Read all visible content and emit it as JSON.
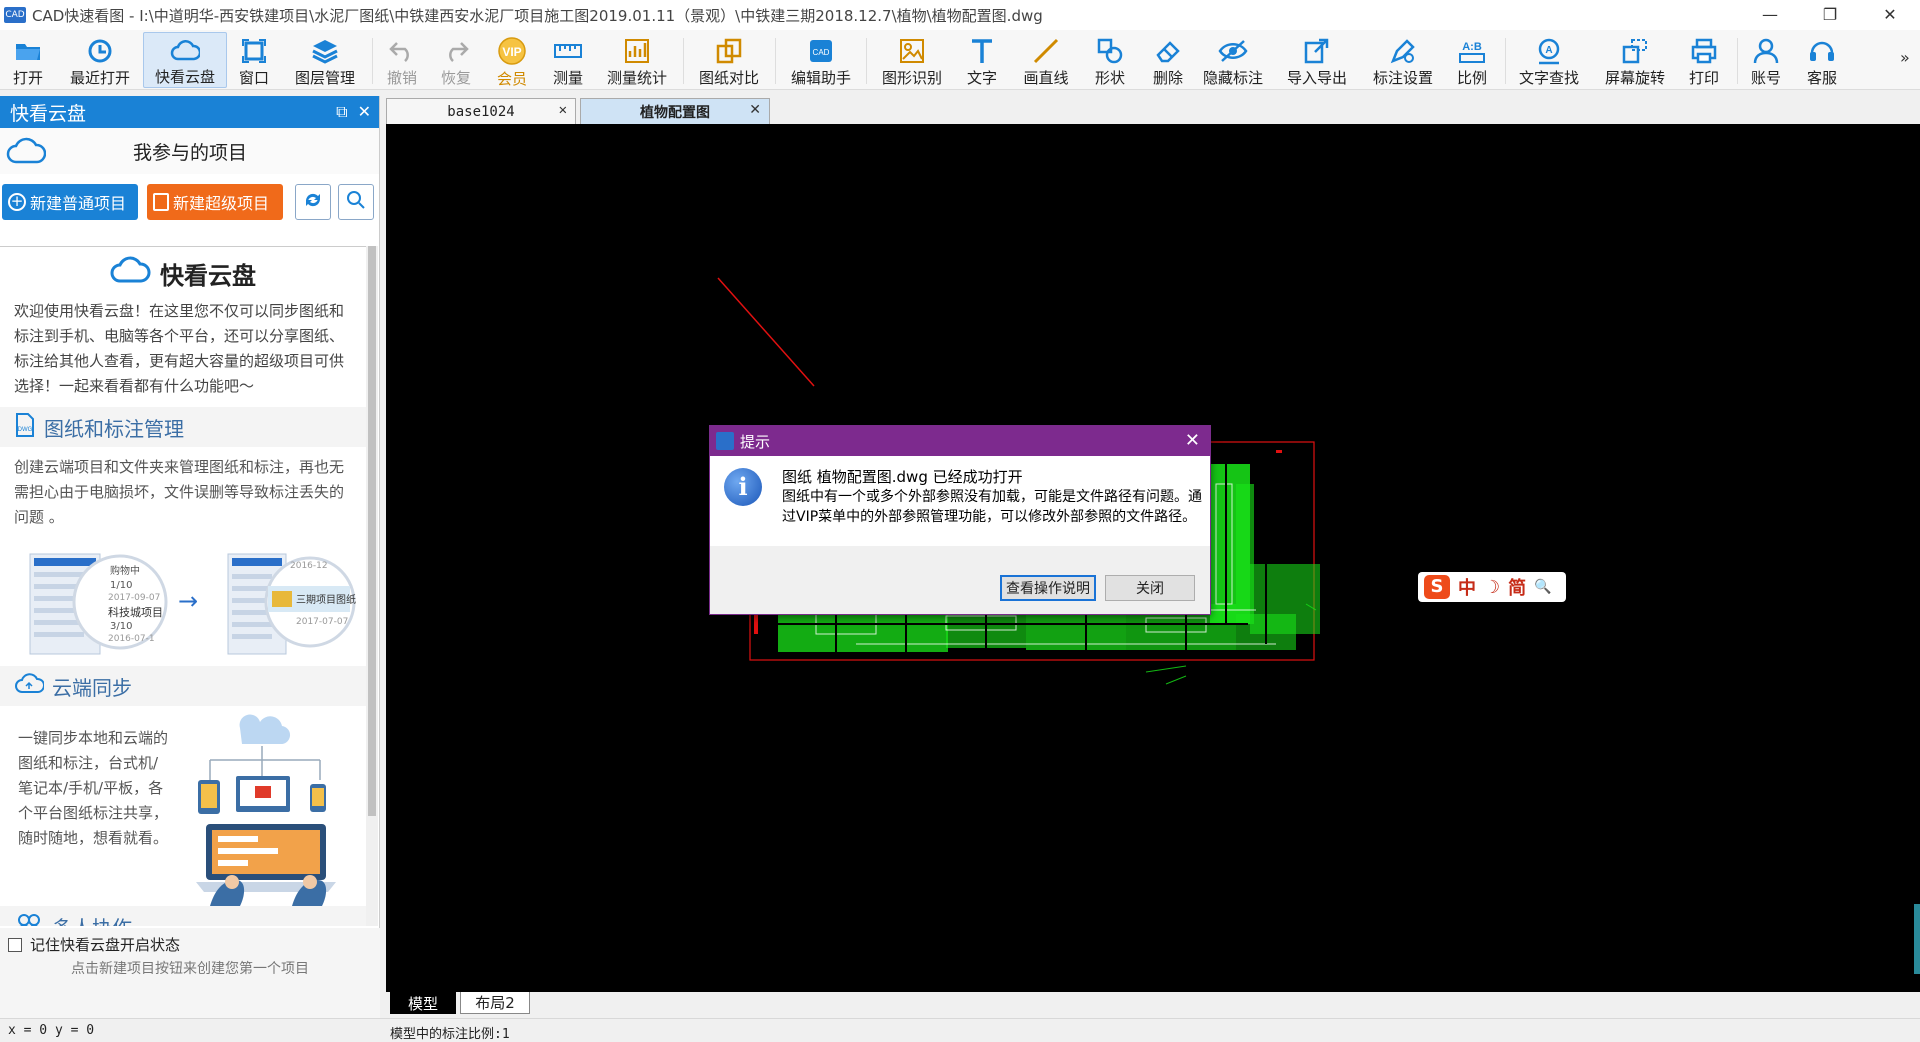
{
  "window": {
    "app_icon_text": "CAD",
    "title": "CAD快速看图 - I:\\中道明华-西安铁建项目\\水泥厂图纸\\中铁建西安水泥厂项目施工图2019.01.11（景观）\\中铁建三期2018.12.7\\植物\\植物配置图.dwg",
    "minimize": "—",
    "restore": "❐",
    "close": "✕"
  },
  "toolbar": {
    "items": [
      {
        "label": "打开",
        "icon": "folder-open-icon"
      },
      {
        "label": "最近打开",
        "icon": "history-icon"
      },
      {
        "label": "快看云盘",
        "icon": "cloud-icon"
      },
      {
        "label": "窗口",
        "icon": "window-icon"
      },
      {
        "label": "图层管理",
        "icon": "layers-icon"
      },
      {
        "label": "撤销",
        "icon": "undo-icon"
      },
      {
        "label": "恢复",
        "icon": "redo-icon"
      },
      {
        "label": "会员",
        "icon": "vip-icon",
        "badge": "VIP"
      },
      {
        "label": "测量",
        "icon": "ruler-icon"
      },
      {
        "label": "测量统计",
        "icon": "measure-stats-icon"
      },
      {
        "label": "图纸对比",
        "icon": "compare-icon"
      },
      {
        "label": "编辑助手",
        "icon": "edit-assistant-icon"
      },
      {
        "label": "图形识别",
        "icon": "shape-recognize-icon"
      },
      {
        "label": "文字",
        "icon": "text-icon"
      },
      {
        "label": "画直线",
        "icon": "line-icon"
      },
      {
        "label": "形状",
        "icon": "shapes-icon"
      },
      {
        "label": "删除",
        "icon": "eraser-icon"
      },
      {
        "label": "隐藏标注",
        "icon": "hide-annotation-icon"
      },
      {
        "label": "导入导出",
        "icon": "import-export-icon"
      },
      {
        "label": "标注设置",
        "icon": "annotation-settings-icon"
      },
      {
        "label": "比例",
        "icon": "scale-icon",
        "badge": "A:B"
      },
      {
        "label": "文字查找",
        "icon": "text-search-icon"
      },
      {
        "label": "屏幕旋转",
        "icon": "rotate-screen-icon"
      },
      {
        "label": "打印",
        "icon": "print-icon"
      },
      {
        "label": "账号",
        "icon": "account-icon"
      },
      {
        "label": "客服",
        "icon": "headset-icon"
      }
    ],
    "more": "»"
  },
  "left_panel": {
    "header": "快看云盘",
    "project_title": "我参与的项目",
    "new_normal_project": "新建普通项目",
    "new_super_project": "新建超级项目",
    "brand_title": "快看云盘",
    "intro": "欢迎使用快看云盘！在这里您不仅可以同步图纸和标注到手机、电脑等各个平台，还可以分享图纸、标注给其他人查看，更有超大容量的超级项目可供选择！一起来看看都有什么功能吧～",
    "sections": [
      {
        "title": "图纸和标注管理",
        "body": "创建云端项目和文件夹来管理图纸和标注，再也无需担心由于电脑损坏，文件误删等导致标注丢失的问题 。"
      },
      {
        "title": "云端同步",
        "body": "一键同步本地和云端的图纸和标注，台式机/笔记本/手机/平板，各个平台图纸标注共享，随时随地，想看就看。"
      },
      {
        "title": "多人协作",
        "body": ""
      }
    ],
    "illustration": {
      "left_line1": "购物中",
      "left_date1": "1/10",
      "left_date2": "2017-09-07",
      "left_project": "科技城项目",
      "left_date3": "3/10",
      "left_date4": "2016-07-1",
      "right_date1": "2016-12",
      "right_project": "三期项目图纸",
      "right_date2": "2017-07-07",
      "arrow": "→"
    },
    "remember_label": "记住快看云盘开启状态",
    "hint": "点击新建项目按钮来创建您第一个项目"
  },
  "tabs": [
    {
      "label": "base1024",
      "active": false
    },
    {
      "label": "植物配置图",
      "active": true
    }
  ],
  "tab_close": "✕",
  "bottom_tabs": [
    {
      "label": "模型",
      "active": true
    },
    {
      "label": "布局2",
      "active": false
    }
  ],
  "status": {
    "coord": "x = 0 y = 0",
    "scale": "模型中的标注比例:1"
  },
  "dialog": {
    "title": "提示",
    "close": "✕",
    "info_glyph": "i",
    "line1": "图纸 植物配置图.dwg 已经成功打开",
    "line2": "图纸中有一个或多个外部参照没有加载，可能是文件路径有问题。通过VIP菜单中的外部参照管理功能，可以修改外部参照的文件路径。",
    "btn_help": "查看操作说明",
    "btn_close": "关闭"
  },
  "ime": {
    "logo": "S",
    "mode": "中",
    "moon": "☽",
    "simplified": "简",
    "search": "🔍"
  },
  "colors": {
    "accent_blue": "#1a82d6",
    "accent_orange": "#f06a1a",
    "dialog_purple": "#7d2a8e",
    "canvas_bg": "#000000",
    "drawing_green": "#19e619",
    "drawing_red": "#e01010"
  }
}
